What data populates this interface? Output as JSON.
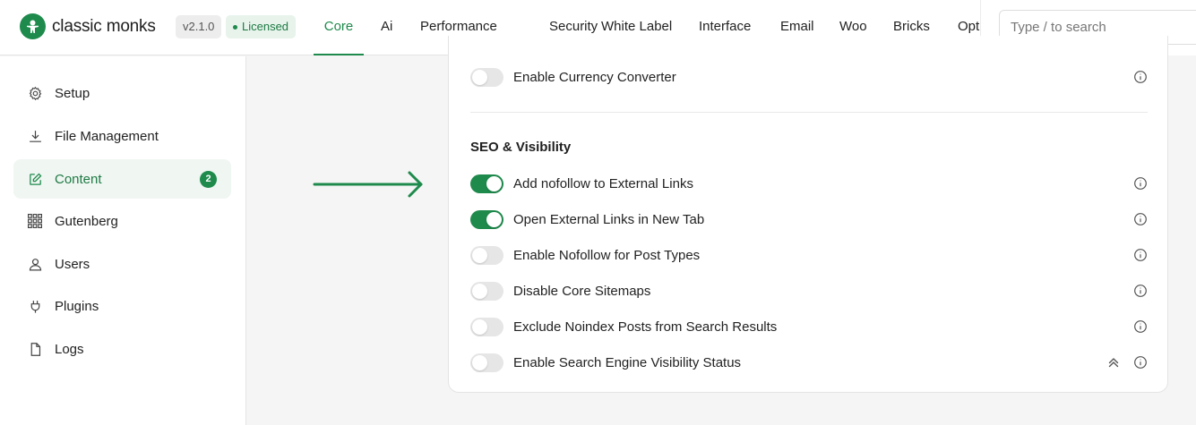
{
  "brand": {
    "name": "classic monks",
    "version": "v2.1.0",
    "license": "Licensed",
    "accent": "#1e8a4c"
  },
  "nav": {
    "tabs": [
      {
        "label": "Core",
        "active": true
      },
      {
        "label": "Ai"
      },
      {
        "label": "Performance"
      },
      {
        "label": "Security"
      },
      {
        "label": "White Label"
      },
      {
        "label": "Interface"
      },
      {
        "label": "Email"
      },
      {
        "label": "Woo"
      },
      {
        "label": "Bricks"
      },
      {
        "label": "Opt"
      }
    ]
  },
  "search": {
    "placeholder": "Type / to search",
    "value": ""
  },
  "sidebar": {
    "items": [
      {
        "label": "Setup",
        "icon": "gear-icon"
      },
      {
        "label": "File Management",
        "icon": "download-icon"
      },
      {
        "label": "Content",
        "icon": "edit-icon",
        "active": true,
        "badge": "2"
      },
      {
        "label": "Gutenberg",
        "icon": "grid-icon"
      },
      {
        "label": "Users",
        "icon": "user-icon"
      },
      {
        "label": "Plugins",
        "icon": "plug-icon"
      },
      {
        "label": "Logs",
        "icon": "file-icon"
      }
    ]
  },
  "settings": {
    "top_row": {
      "label": "Enable Currency Converter",
      "enabled": false
    },
    "section_title": "SEO & Visibility",
    "rows": [
      {
        "label": "Add nofollow to External Links",
        "enabled": true
      },
      {
        "label": "Open External Links in New Tab",
        "enabled": true
      },
      {
        "label": "Enable Nofollow for Post Types",
        "enabled": false
      },
      {
        "label": "Disable Core Sitemaps",
        "enabled": false
      },
      {
        "label": "Exclude Noindex Posts from Search Results",
        "enabled": false
      },
      {
        "label": "Enable Search Engine Visibility Status",
        "enabled": false
      }
    ]
  }
}
